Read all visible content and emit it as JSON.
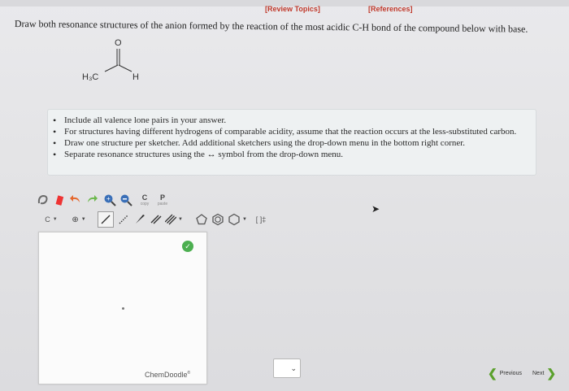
{
  "header": {
    "review_link": "[Review Topics]",
    "references_link": "[References]"
  },
  "question": "Draw both resonance structures of the anion formed by the reaction of the most acidic C-H bond of the compound below with base.",
  "molecule": {
    "oxygen_label": "O",
    "left_label": "H₃C",
    "right_label": "H"
  },
  "instructions": [
    "Include all valence lone pairs in your answer.",
    "For structures having different hydrogens of comparable acidity, assume that the reaction occurs at the less-substituted carbon.",
    "Draw one structure per sketcher. Add additional sketchers using the drop-down menu in the bottom right corner.",
    "Separate resonance structures using the ↔ symbol from the drop-down menu."
  ],
  "toolbar": {
    "copy_letter": "C",
    "copy_label": "copy",
    "paste_letter": "P",
    "paste_label": "paste",
    "carbon_label": "C",
    "charge_label": "[ ]‡"
  },
  "sketcher": {
    "brand": "ChemDoodle",
    "brand_mark": "®"
  },
  "navigation": {
    "previous": "Previous",
    "next": "Next"
  },
  "colors": {
    "link_red": "#c0392b",
    "nav_green": "#5aa02c",
    "ok_green": "#4caf50"
  }
}
